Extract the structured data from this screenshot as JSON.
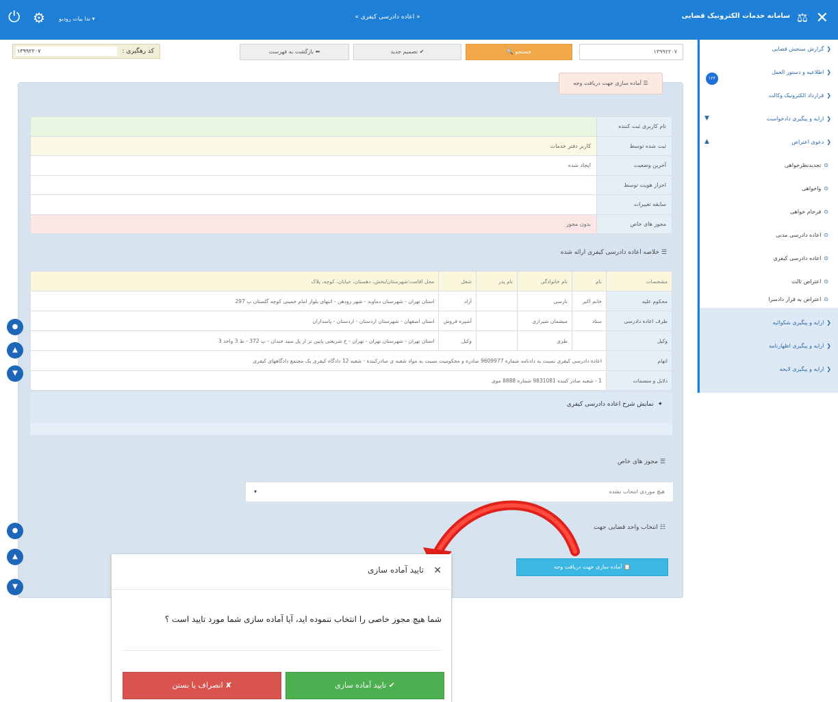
{
  "topbar": {
    "close_icon": "✕",
    "app_name": "سامانه خدمات الکترونیک قضایی",
    "page_title": "« اعاده دادرسی کیفری »",
    "notifications": "▾ ندا بیات رودبو"
  },
  "sidebar": {
    "badge": "۱۲۴",
    "items": [
      "گزارش سنجش قضایی",
      "اطلاعیه و دستور العمل",
      "قرارداد الکترونیک وکالت",
      "ارایه و پیگیری دادخواست",
      "دعوی اعتراض",
      "تجدیدنظرخواهی",
      "واخواهی",
      "فرجام خواهی",
      "اعاده دادرسی مدنی",
      "اعاده دادرسی کیفری",
      "اعتراض ثالث",
      "اعتراض به قرار دادسرا",
      "ارایه و پیگیری شکوائیه",
      "ارایه و پیگیری اظهارنامه",
      "ارایه و پیگیری لایحه"
    ]
  },
  "toolbar": {
    "tracking_label": "کد رهگیری :",
    "tracking_value": "۱۳۹۹۲۲۰۷",
    "back_button": "⬅ بازگشت به فهرست",
    "new_button": "✔ تصمیم جدید",
    "search_button": "جستجو 🔍",
    "search_value": "۱۳۹۹۲۲۰۷"
  },
  "section": {
    "title": "☰ آماده سازی جهت دریافت وجه"
  },
  "info_rows": [
    {
      "label": "نام کاربری ثبت کننده",
      "value": ""
    },
    {
      "label": "ثبت شده توسط",
      "value": "کاربر دفتر خدمات"
    },
    {
      "label": "آخرین وضعیت",
      "value": "ایجاد شده"
    },
    {
      "label": "احراز هویت توسط",
      "value": ""
    },
    {
      "label": "سابقه تغییرات",
      "value": ""
    },
    {
      "label": "مجوز های خاص",
      "value": "بدون مجوز"
    }
  ],
  "summary": {
    "title": "خلاصه اعاده دادرسی کیفری ارائه شده"
  },
  "parties": {
    "headers": [
      "مشخصات",
      "نام",
      "نام خانوادگی",
      "نام پدر",
      "شغل",
      "محل اقامت:شهرستان/بخش، دهستان، خیابان، کوچه، پلاک"
    ],
    "rows": [
      {
        "key": "محکوم علیه",
        "name": "خانم اکبر",
        "family": "نارسی",
        "father": "",
        "job": "آزاد",
        "address": "استان تهران - شهرستان دماوند - شهر رودهن - انتهای بلوار امام خمینی کوچه گلستان پ 297"
      },
      {
        "key": "طرف اعاده دادرسی",
        "name": "ستاد",
        "family": "مبشمان شیرازی",
        "father": "",
        "job": "آشپزه فروش",
        "address": "استان اصفهان - شهرستان اردستان - اردستان - پاسداران"
      },
      {
        "key": "وکیل",
        "name": "",
        "family": "طری",
        "father": "",
        "job": "وکیل",
        "address": "استان تهران - شهرستان تهران - تهران - خ شریعتی پایین تر از پل سید خندان - پ 372 - ط 3 واحد 3"
      },
      {
        "key": "اتهام",
        "wide": "اعاده دادرسی کیفری نسبت به دادنامه شماره 9609977 صادره و محکومیت نسبت به مواد شعبه ی صادرکننده - شعبه 12 دادگاه کیفری یک مجتمع دادگاههای کیفری"
      },
      {
        "key": "دلایل و منضمات",
        "wide": "1 - شعبه صادر کننده     9831081 شماره 8888 موی"
      }
    ]
  },
  "toggle": {
    "label": "نمایش شرح اعاده دادرسی کیفری",
    "icon": "✦"
  },
  "permits": {
    "title": "مجوز های خاص",
    "select_value": "هیچ موردی انتخاب نشده",
    "caret": "▾"
  },
  "unit": {
    "title": "انتخاب واحد قضایی جهت"
  },
  "actions": {
    "prepare_button": "📋 آماده سازی جهت دریافت وجه"
  },
  "modal": {
    "close": "✕",
    "title": "تایید آماده سازی",
    "message": "شما هیچ مجوز خاصی را انتخاب ننموده اید، آیا آماده سازی شما مورد تایید است ؟",
    "ok": "✔ تایید آماده سازی",
    "cancel": "✘ انصراف یا بستن"
  },
  "colors": {
    "topbar": "#1e7fd6",
    "panel": "#d7e4ef",
    "orange": "#f0a84a",
    "cyan": "#3cb6e3",
    "ok_green": "#4caf50",
    "cancel_red": "#d9534f",
    "curve_red": "#e0201a",
    "row_green": "#e9f7e2",
    "row_yellow": "#fbf9e3",
    "row_pink": "#fbe6e6"
  },
  "icons": {
    "power": "⏻",
    "gear": "⚙",
    "scales": "⚖",
    "drop": "●",
    "up": "▲",
    "down": "▼"
  }
}
